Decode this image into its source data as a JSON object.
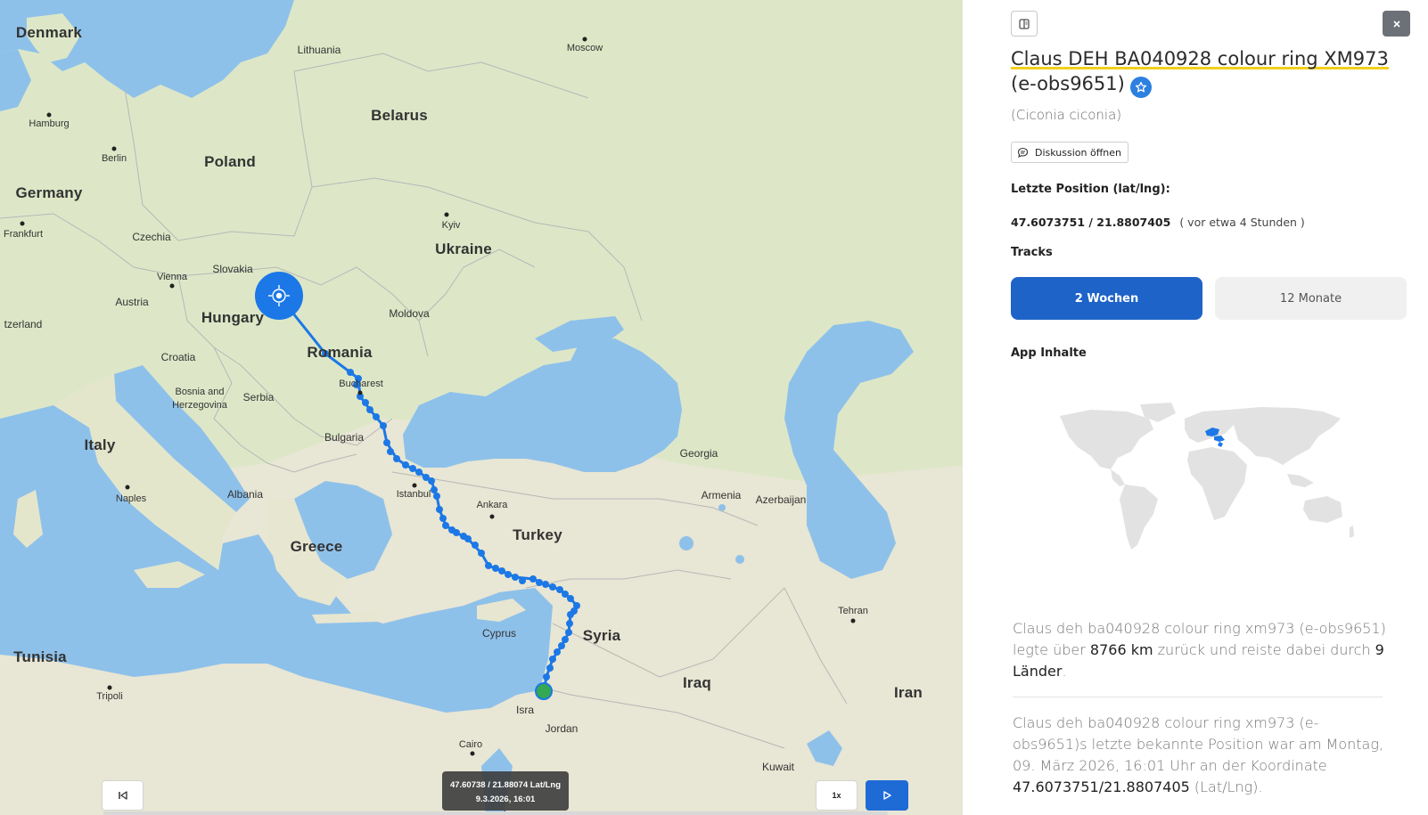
{
  "map": {
    "countries": [
      {
        "name": "Denmark"
      },
      {
        "name": "Lithuania"
      },
      {
        "name": "Belarus"
      },
      {
        "name": "Poland"
      },
      {
        "name": "Germany"
      },
      {
        "name": "Ukraine"
      },
      {
        "name": "Czechia"
      },
      {
        "name": "Slovakia"
      },
      {
        "name": "Austria"
      },
      {
        "name": "Hungary"
      },
      {
        "name": "Moldova"
      },
      {
        "name": "Romania"
      },
      {
        "name": "Croatia"
      },
      {
        "name": "Bosnia and"
      },
      {
        "name": "Herzegovina"
      },
      {
        "name": "Serbia"
      },
      {
        "name": "Italy"
      },
      {
        "name": "Bulgaria"
      },
      {
        "name": "Georgia"
      },
      {
        "name": "Albania"
      },
      {
        "name": "Armenia"
      },
      {
        "name": "Azerbaijan"
      },
      {
        "name": "Turkey"
      },
      {
        "name": "Greece"
      },
      {
        "name": "Syria"
      },
      {
        "name": "Cyprus"
      },
      {
        "name": "Tunisia"
      },
      {
        "name": "Iraq"
      },
      {
        "name": "Iran"
      },
      {
        "name": "Jordan"
      },
      {
        "name": "Kuwait"
      },
      {
        "name": "tzerland"
      },
      {
        "name": "Isra"
      }
    ],
    "cities": [
      {
        "name": "Moscow"
      },
      {
        "name": "Hamburg"
      },
      {
        "name": "Berlin"
      },
      {
        "name": "Frankfurt"
      },
      {
        "name": "Kyiv"
      },
      {
        "name": "Vienna"
      },
      {
        "name": "Bucharest"
      },
      {
        "name": "Istanbul"
      },
      {
        "name": "Ankara"
      },
      {
        "name": "Naples"
      },
      {
        "name": "Tehran"
      },
      {
        "name": "Tripoli"
      },
      {
        "name": "Cairo"
      }
    ],
    "tooltip": {
      "coords": "47.60738 / 21.88074 Lat/Lng",
      "datetime": "9.3.2026, 16:01"
    },
    "speed_label": "1x",
    "accent_color": "#1f6bd6",
    "icons": [
      "skip-back-icon",
      "play-icon",
      "target-icon"
    ]
  },
  "panel": {
    "title_highlighted": "Claus DEH BA040928 colour ring XM973",
    "title_rest": " (e-obs9651)",
    "scientific_name": "(Ciconia ciconia)",
    "discuss_label": "Diskussion öffnen",
    "position_label": "Letzte Position (lat/lng):",
    "position_value": "47.6073751 / 21.8807405",
    "position_ago": "( vor etwa 4 Stunden )",
    "tracks_label": "Tracks",
    "tabs": [
      {
        "label": "2 Wochen",
        "active": true
      },
      {
        "label": "12 Monate",
        "active": false
      }
    ],
    "app_content_label": "App Inhalte",
    "summary": {
      "prefix": "Claus deh ba040928 colour ring xm973 (e-obs9651) legte über ",
      "distance": "8766 km",
      "middle": " zurück und reiste dabei durch ",
      "countries": "9 Länder",
      "suffix": "."
    },
    "last_known": {
      "prefix": "Claus deh ba040928 colour ring xm973 (e-obs9651)s letzte bekannte Position war am Montag, 09. März 2026, 16:01 Uhr an der Koordinate ",
      "coordinate": "47.6073751/21.8807405",
      "suffix": " (Lat/Lng)."
    },
    "icons": [
      "sidebar-toggle-icon",
      "close-icon",
      "star-icon",
      "chat-icon"
    ]
  }
}
